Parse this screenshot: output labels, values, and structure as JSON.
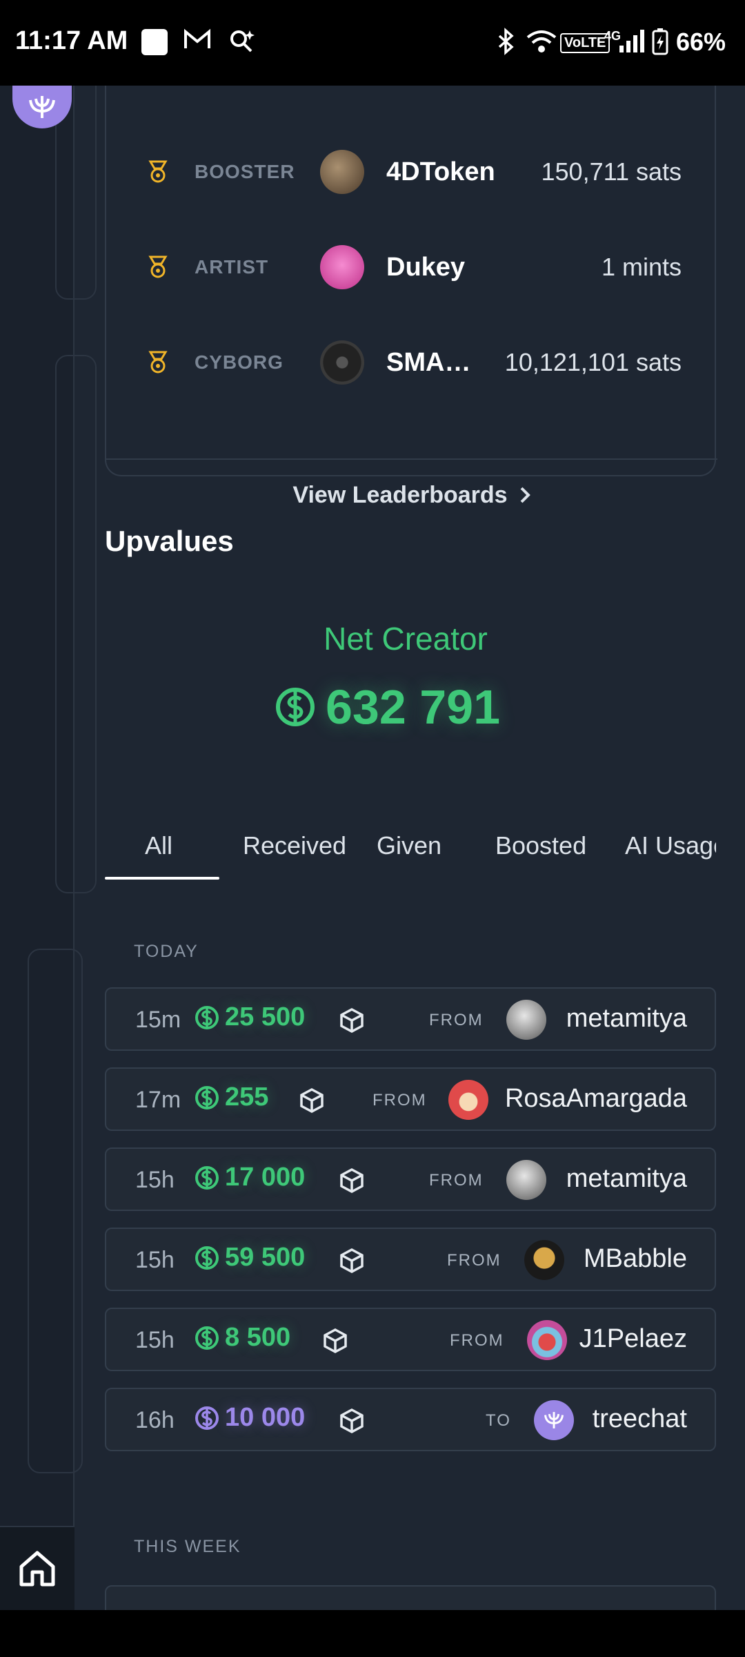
{
  "status_bar": {
    "time": "11:17 AM",
    "battery": "66%",
    "network": "4G",
    "volte": "VoLTE"
  },
  "leaderboard": {
    "rows": [
      {
        "role": "BOOSTER",
        "name": "4DToken",
        "value": "150,711 sats",
        "avatar_color": "#6b5b4a"
      },
      {
        "role": "ARTIST",
        "name": "Dukey",
        "value": "1 mints",
        "avatar_color": "#e35fb3"
      },
      {
        "role": "CYBORG",
        "name": "SMA…",
        "value": "10,121,101 sats",
        "avatar_color": "#2b2b2b"
      }
    ],
    "footer_label": "View Leaderboards"
  },
  "upvalues": {
    "title": "Upvalues",
    "net_label": "Net Creator",
    "net_value": "632 791"
  },
  "tabs": [
    {
      "label": "All",
      "active": true
    },
    {
      "label": "Received",
      "active": false
    },
    {
      "label": "Given",
      "active": false
    },
    {
      "label": "Boosted",
      "active": false
    },
    {
      "label": "AI Usage",
      "active": false
    }
  ],
  "groups": {
    "today": "TODAY",
    "this_week": "THIS WEEK"
  },
  "transactions": [
    {
      "time": "15m",
      "amount": "25 500",
      "direction": "FROM",
      "user": "metamitya",
      "color": "green",
      "avatar_color": "#9aa3ab"
    },
    {
      "time": "17m",
      "amount": "255",
      "direction": "FROM",
      "user": "RosaAmargada",
      "color": "green",
      "avatar_color": "#e04a4a"
    },
    {
      "time": "15h",
      "amount": "17 000",
      "direction": "FROM",
      "user": "metamitya",
      "color": "green",
      "avatar_color": "#9aa3ab"
    },
    {
      "time": "15h",
      "amount": "59 500",
      "direction": "FROM",
      "user": "MBabble",
      "color": "green",
      "avatar_color": "#c9a040"
    },
    {
      "time": "15h",
      "amount": "8 500",
      "direction": "FROM",
      "user": "J1Pelaez",
      "color": "green",
      "avatar_color": "#c44d9a"
    },
    {
      "time": "16h",
      "amount": "10 000",
      "direction": "TO",
      "user": "treechat",
      "color": "purple",
      "avatar_color": "#9a86e6"
    }
  ],
  "colors": {
    "accent_green": "#3ec878",
    "accent_purple": "#9c88ea",
    "medal_gold": "#f0b429"
  }
}
